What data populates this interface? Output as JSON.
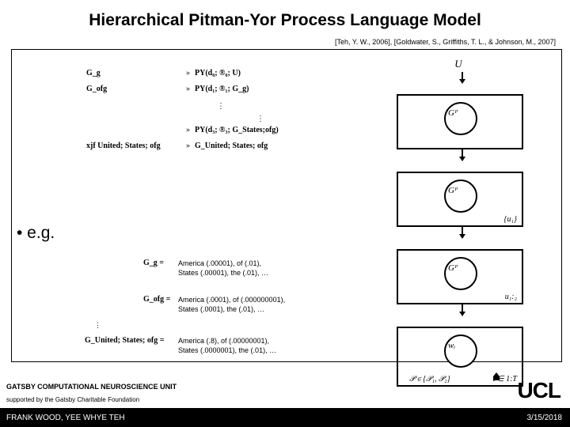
{
  "title": "Hierarchical Pitman-Yor Process Language Model",
  "citation": "[Teh, Y. W., 2006], [Goldwater, S., Griffiths, T. L., & Johnson, M., 2007]",
  "definitions": {
    "rows": [
      {
        "lhs": "G_g",
        "rhs": "PY(d₀; ®₀; U)"
      },
      {
        "lhs": "G_ofg",
        "rhs": "PY(d₁; ®₁; G_g)"
      },
      {
        "lhs": "",
        "rhs": "PY(d₃; ®₃; G_States;ofg)"
      },
      {
        "lhs": "xjf United; States; ofg",
        "rhs": "G_United; States; ofg"
      }
    ]
  },
  "eg_label": "• e.g.",
  "examples": [
    {
      "lhs": "G_g =",
      "rhs": "America (.00001), of (.01),\nStates (.00001), the (.01), …"
    },
    {
      "lhs": "G_ofg =",
      "rhs": "America (.0001), of (.000000001),\nStates (.0001), the (.01), …"
    },
    {
      "lhs": "G_United; States; ofg =",
      "rhs": "America (.8), of (.00000001),\nStates (.0000001), the (.01), …"
    }
  ],
  "figure": {
    "top_label": "U",
    "boxes": [
      {
        "node": "Gᴾ",
        "sub": ""
      },
      {
        "node": "Gᴾ",
        "sub": "{u₁}"
      },
      {
        "node": "Gᴾ",
        "sub": "u₁:₂"
      },
      {
        "node": "wᵢ",
        "sub": "t ∈ 1:T"
      }
    ],
    "bottom_text": "𝒫 ∈ {𝒫₁, 𝒫₂}"
  },
  "footer": {
    "unit": "GATSBY COMPUTATIONAL NEUROSCIENCE UNIT",
    "support": "supported by the Gatsby Charitable Foundation",
    "authors": "FRANK WOOD, YEE WHYE TEH",
    "date": "3/15/2018",
    "logo": "UCL"
  }
}
